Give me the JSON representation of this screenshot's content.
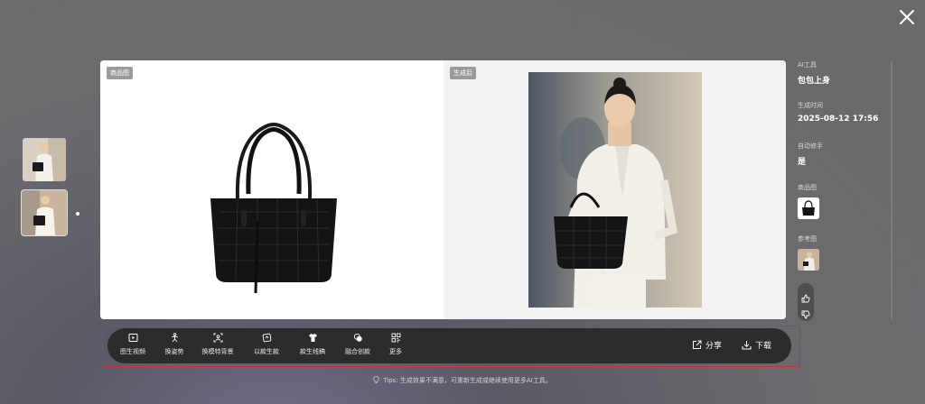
{
  "viewer": {
    "close_icon": "close-icon"
  },
  "thumbnails": [
    {
      "name": "thumbnail-1",
      "selected": false
    },
    {
      "name": "thumbnail-2",
      "selected": true
    }
  ],
  "main": {
    "left_tag": "商品图",
    "right_tag": "生成后"
  },
  "info": {
    "tool_label": "AI工具",
    "tool_value": "包包上身",
    "time_label": "生成时间",
    "time_value": "2025-08-12 17:56",
    "auto_hand_label": "自动修手",
    "auto_hand_value": "是",
    "product_label": "商品图",
    "reference_label": "参考图"
  },
  "toolbar": {
    "tools": [
      {
        "label": "图生视频",
        "icon": "video-icon"
      },
      {
        "label": "换姿势",
        "icon": "pose-icon"
      },
      {
        "label": "换模特背景",
        "icon": "model-scan-icon"
      },
      {
        "label": "以款生款",
        "icon": "style-icon"
      },
      {
        "label": "款生线稿",
        "icon": "shirt-icon"
      },
      {
        "label": "融合创款",
        "icon": "fusion-icon"
      },
      {
        "label": "更多",
        "icon": "grid-icon"
      }
    ],
    "share_label": "分享",
    "download_label": "下载"
  },
  "tips": "Tips: 生成效果不满意，可重新生成或继续使用更多AI工具。",
  "colors": {
    "toolbar_bg": "#2c2c2e",
    "highlight_border": "#e02a2a",
    "tag_bg": "#9a9a9a"
  }
}
